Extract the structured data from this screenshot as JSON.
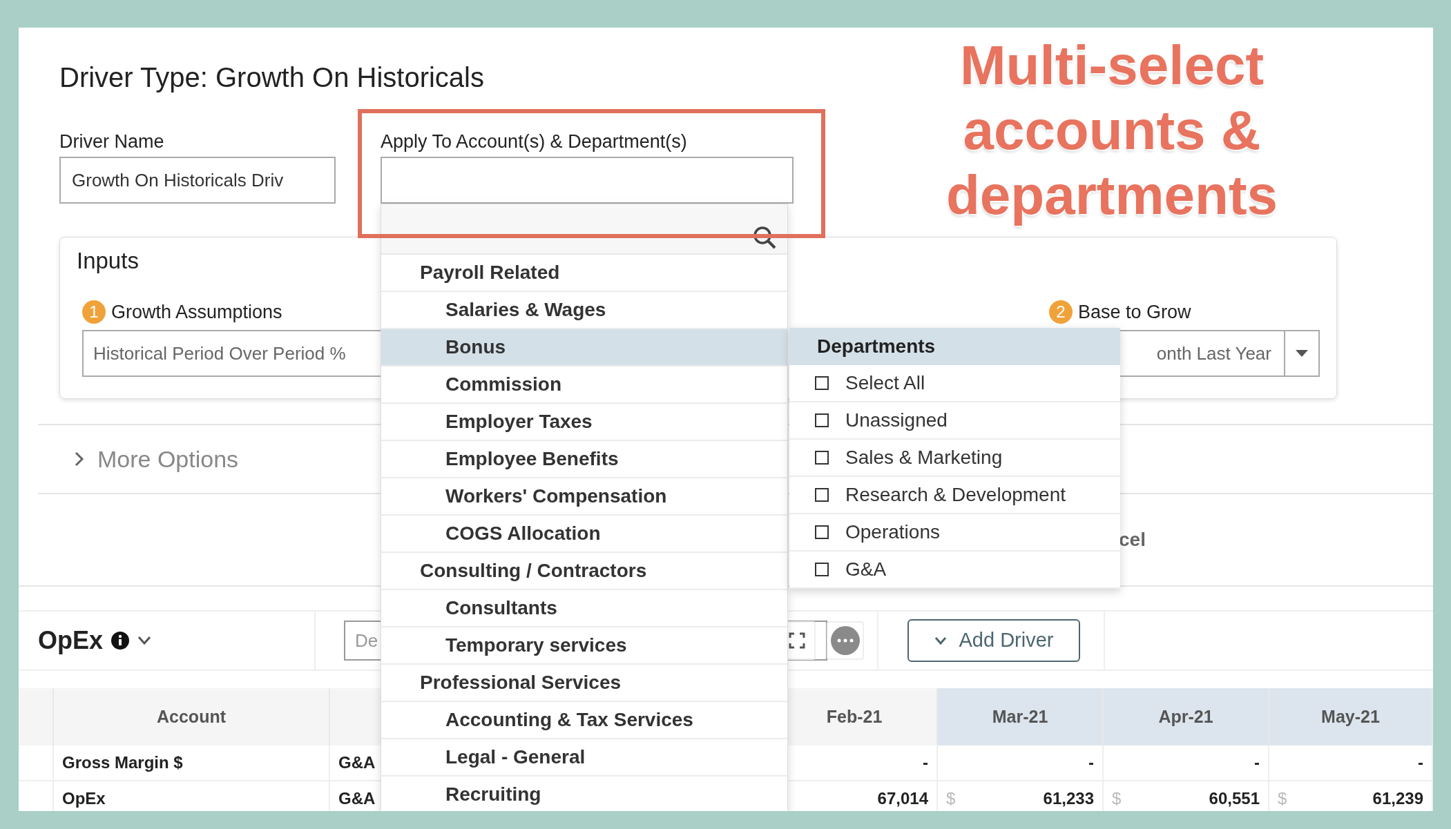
{
  "title": "Driver Type: Growth On Historicals",
  "driver_name": {
    "label": "Driver Name",
    "value": "Growth On Historicals Driv"
  },
  "apply_to": {
    "label": "Apply To Account(s) & Department(s)"
  },
  "inputs": {
    "title": "Inputs",
    "fields": [
      {
        "number": "1",
        "label": "Growth Assumptions",
        "value": "Historical Period Over Period %"
      },
      {
        "number": "2",
        "label": "Base to Grow",
        "value": "onth Last Year"
      }
    ]
  },
  "more_options": {
    "label": "More Options",
    "expanded": false
  },
  "cancel_fragment": "cel",
  "section": {
    "title": "OpEx",
    "search": {
      "placeholder": "De"
    },
    "add_button": "Add Driver"
  },
  "table": {
    "account_header": "Account",
    "month_columns": [
      {
        "label": "Feb-21",
        "highlighted": false
      },
      {
        "label": "Mar-21",
        "highlighted": true
      },
      {
        "label": "Apr-21",
        "highlighted": true
      },
      {
        "label": "May-21",
        "highlighted": true
      }
    ],
    "rows": [
      {
        "account": "Gross Margin $",
        "column_3": "G&A",
        "months": [
          {
            "value": "-"
          },
          {
            "value": "-"
          },
          {
            "value": "-"
          },
          {
            "value": "-"
          }
        ]
      },
      {
        "account": "OpEx",
        "column_3": "G&A",
        "months": [
          {
            "value": "67,014"
          },
          {
            "currency": "$",
            "value": "61,233"
          },
          {
            "currency": "$",
            "value": "60,551"
          },
          {
            "currency": "$",
            "value": "61,239"
          }
        ]
      }
    ]
  },
  "account_menu": {
    "groups": [
      {
        "label": "Payroll Related",
        "selected": false,
        "children": [
          {
            "label": "Salaries & Wages",
            "selected": false
          },
          {
            "label": "Bonus",
            "selected": true
          },
          {
            "label": "Commission",
            "selected": false
          },
          {
            "label": "Employer Taxes",
            "selected": false
          },
          {
            "label": "Employee Benefits",
            "selected": false
          },
          {
            "label": "Workers' Compensation",
            "selected": false
          },
          {
            "label": "COGS Allocation",
            "selected": false
          }
        ]
      },
      {
        "label": "Consulting / Contractors",
        "selected": false,
        "children": [
          {
            "label": "Consultants",
            "selected": false
          },
          {
            "label": "Temporary services",
            "selected": false
          }
        ]
      },
      {
        "label": "Professional Services",
        "selected": false,
        "children": [
          {
            "label": "Accounting & Tax Services",
            "selected": false
          },
          {
            "label": "Legal - General",
            "selected": false
          },
          {
            "label": "Recruiting",
            "selected": false
          }
        ]
      }
    ]
  },
  "department_menu": {
    "title": "Departments",
    "options": [
      {
        "label": "Select All",
        "checked": false
      },
      {
        "label": "Unassigned",
        "checked": false
      },
      {
        "label": "Sales & Marketing",
        "checked": false
      },
      {
        "label": "Research & Development",
        "checked": false
      },
      {
        "label": "Operations",
        "checked": false
      },
      {
        "label": "G&A",
        "checked": false
      }
    ]
  },
  "annotation": {
    "text": "Multi-select accounts & departments"
  }
}
